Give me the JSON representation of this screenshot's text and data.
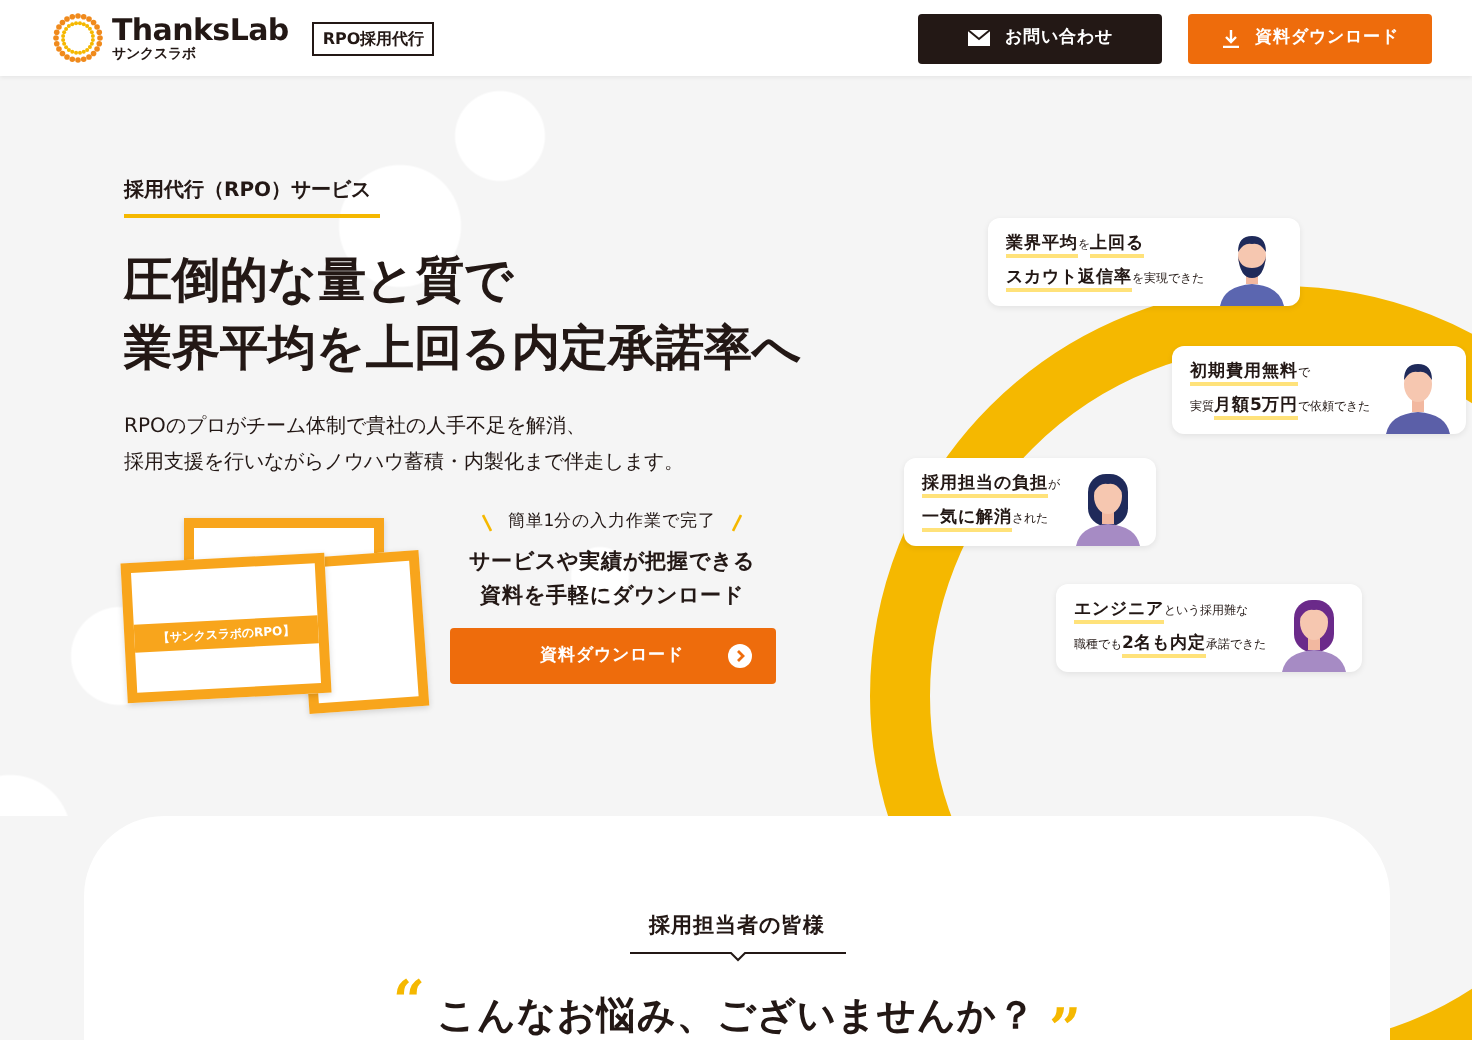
{
  "header": {
    "logo": {
      "name": "ThanksLab",
      "subname": "サンクスラボ"
    },
    "badge": "RPO採用代行",
    "buttons": [
      {
        "kind": "contact",
        "label": "お問い合わせ"
      },
      {
        "kind": "download",
        "label": "資料ダウンロード"
      }
    ]
  },
  "hero": {
    "tag": "採用代行（RPO）サービス",
    "title_lines": [
      "圧倒的な量と質で",
      "業界平均を上回る内定承諾率へ"
    ],
    "description_lines": [
      "RPOのプロがチーム体制で貴社の人手不足を解消、",
      "採用支援を行いながらノウハウ蓄積・内製化まで伴走します。"
    ],
    "download": {
      "document_title": "【サンクスラボのRPO】",
      "note": "簡単1分の入力作業で完了",
      "lines": [
        "サービスや実績が把握できる",
        "資料を手軽にダウンロード"
      ],
      "button": "資料ダウンロード"
    },
    "testimonials": [
      {
        "kind": "bearded",
        "lines": [
          "**業界平均**を**上回る**",
          "**スカウト返信率**を実現できた"
        ]
      },
      {
        "kind": "man",
        "lines": [
          "**初期費用無料**で",
          "実質**月額5万円**で依頼できた"
        ]
      },
      {
        "kind": "woman",
        "lines": [
          "**採用担当の負担**が",
          "**一気に解消**された"
        ]
      },
      {
        "kind": "ponytail",
        "lines": [
          "**エンジニア**という採用難な",
          "職種でも**2名も内定**承諾できた"
        ]
      }
    ]
  },
  "concerns": {
    "label": "採用担当者の皆様",
    "open_quote": "“",
    "heading": "こんなお悩み、ございませんか？",
    "close_quote": "”"
  }
}
